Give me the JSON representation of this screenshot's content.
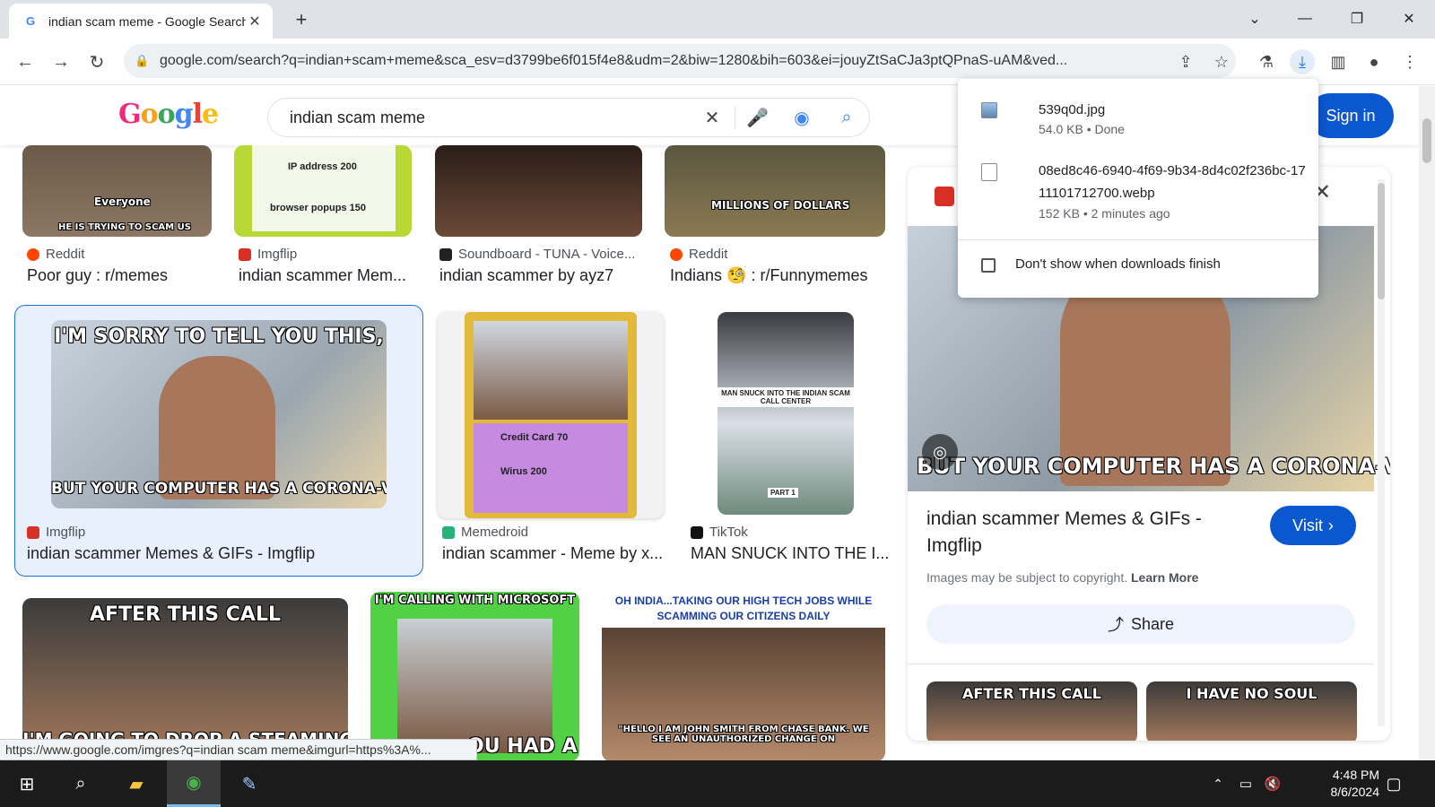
{
  "browser": {
    "tab_title": "indian scam meme - Google Search",
    "new_tab_label": "+",
    "url": "google.com/search?q=indian+scam+meme&sca_esv=d3799be6f015f4e8&udm=2&biw=1280&bih=603&ei=jouyZtSaCJa3ptQPnaS-uAM&ved..."
  },
  "header": {
    "logo_text": "Google",
    "search_value": "indian scam meme",
    "signin_label": "Sign in"
  },
  "results": {
    "row1": [
      {
        "source": "Reddit",
        "title": "Poor guy : r/memes",
        "caption_top": "Everyone",
        "caption_bottom": "HE IS TRYING TO SCAM US",
        "fav_color": "#ff4500"
      },
      {
        "source": "Imgflip",
        "title": "indian scammer Mem...",
        "caption_top": "IP address 200",
        "caption_bottom": "browser popups 150",
        "fav_color": "#d93025"
      },
      {
        "source": "Soundboard - TUNA - Voice...",
        "title": "indian scammer by ayz7",
        "fav_color": "#202124"
      },
      {
        "source": "Reddit",
        "title": "Indians 🧐 : r/Funnymemes",
        "caption_bottom": "MILLIONS OF DOLLARS",
        "fav_color": "#ff4500"
      }
    ],
    "row2": [
      {
        "source": "Imgflip",
        "title": "indian scammer Memes & GIFs - Imgflip",
        "caption_top": "I'M SORRY TO TELL YOU THIS,",
        "caption_bottom": "BUT YOUR COMPUTER HAS A CORONA-VIRUS",
        "fav_color": "#d93025"
      },
      {
        "source": "Memedroid",
        "title": "indian scammer - Meme by x...",
        "caption_top": "Credit Card 70",
        "caption_bottom": "Wirus 200",
        "fav_color": "#25b37a"
      },
      {
        "source": "TikTok",
        "title": "MAN SNUCK INTO THE I...",
        "caption_top": "MAN SNUCK INTO THE INDIAN SCAM CALL CENTER",
        "caption_bottom": "PART 1",
        "fav_color": "#111111"
      }
    ],
    "row3": [
      {
        "caption_top": "AFTER THIS CALL",
        "caption_bottom": "I'M GOING TO DROP A STEAMING"
      },
      {
        "caption_top": "I'M CALLING WITH MICROSOFT",
        "caption_bottom": "OU HAD A"
      },
      {
        "caption_top": "OH INDIA...TAKING OUR HIGH TECH JOBS WHILE SCAMMING OUR CITIZENS DAILY",
        "caption_bottom": "\"HELLO I AM JOHN SMITH FROM CHASE BANK. WE SEE AN UNAUTHORIZED CHANGE ON"
      }
    ]
  },
  "panel": {
    "image_caption": "BUT YOUR COMPUTER HAS A CORONA-VIRUS",
    "title": "indian scammer Memes & GIFs - Imgflip",
    "visit_label": "Visit",
    "copyright_text": "Images may be subject to copyright.",
    "learn_more": "Learn More",
    "share_label": "Share",
    "related": [
      {
        "caption": "AFTER THIS CALL"
      },
      {
        "caption": "I HAVE NO SOUL"
      }
    ]
  },
  "downloads": {
    "items": [
      {
        "name": "539q0d.jpg",
        "meta": "54.0 KB • Done"
      },
      {
        "name": "08ed8c46-6940-4f69-9b34-8d4c02f236bc-1711101712700.webp",
        "meta": "152 KB • 2 minutes ago"
      }
    ],
    "checkbox_label": "Don't show when downloads finish"
  },
  "status_url": "https://www.google.com/imgres?q=indian scam meme&imgurl=https%3A%...",
  "taskbar": {
    "time": "4:48 PM",
    "date": "8/6/2024"
  }
}
